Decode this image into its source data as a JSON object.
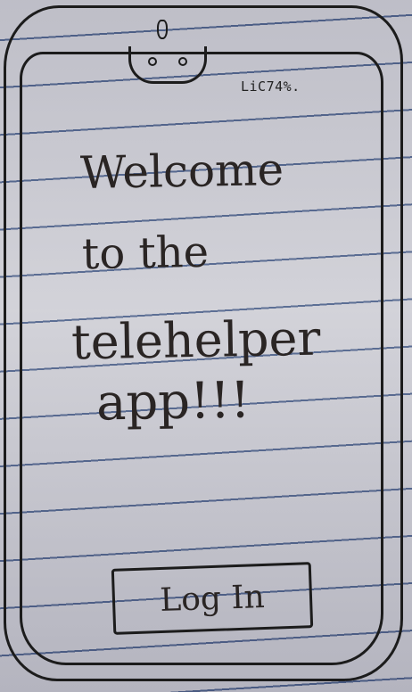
{
  "status_bar": {
    "battery_text": "LiC74%."
  },
  "welcome": {
    "line_1": "Welcome",
    "line_2": "to the",
    "line_3": "telehelper",
    "line_4": "app!!!"
  },
  "login_button": {
    "label": "Log In"
  }
}
